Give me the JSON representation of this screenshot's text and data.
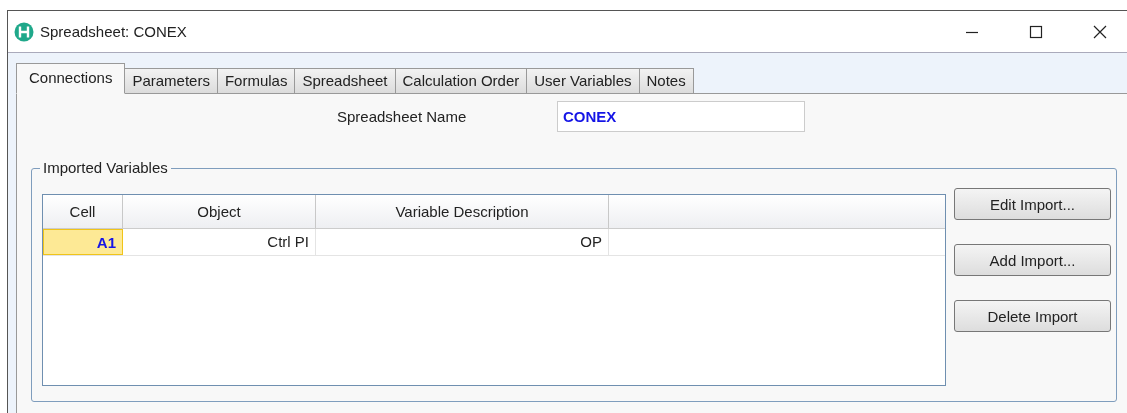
{
  "window": {
    "title": "Spreadsheet: CONEX"
  },
  "tabs": [
    {
      "label": "Connections",
      "selected": true
    },
    {
      "label": "Parameters",
      "selected": false
    },
    {
      "label": "Formulas",
      "selected": false
    },
    {
      "label": "Spreadsheet",
      "selected": false
    },
    {
      "label": "Calculation Order",
      "selected": false
    },
    {
      "label": "User Variables",
      "selected": false
    },
    {
      "label": "Notes",
      "selected": false
    }
  ],
  "spreadsheet_name": {
    "label": "Spreadsheet Name",
    "value": "CONEX"
  },
  "imported_variables": {
    "title": "Imported Variables",
    "columns": [
      "Cell",
      "Object",
      "Variable Description"
    ],
    "rows": [
      {
        "cells": [
          "A1",
          "Ctrl PI",
          "OP"
        ],
        "selected": true
      }
    ]
  },
  "buttons": [
    "Edit Import...",
    "Add Import...",
    "Delete Import"
  ]
}
